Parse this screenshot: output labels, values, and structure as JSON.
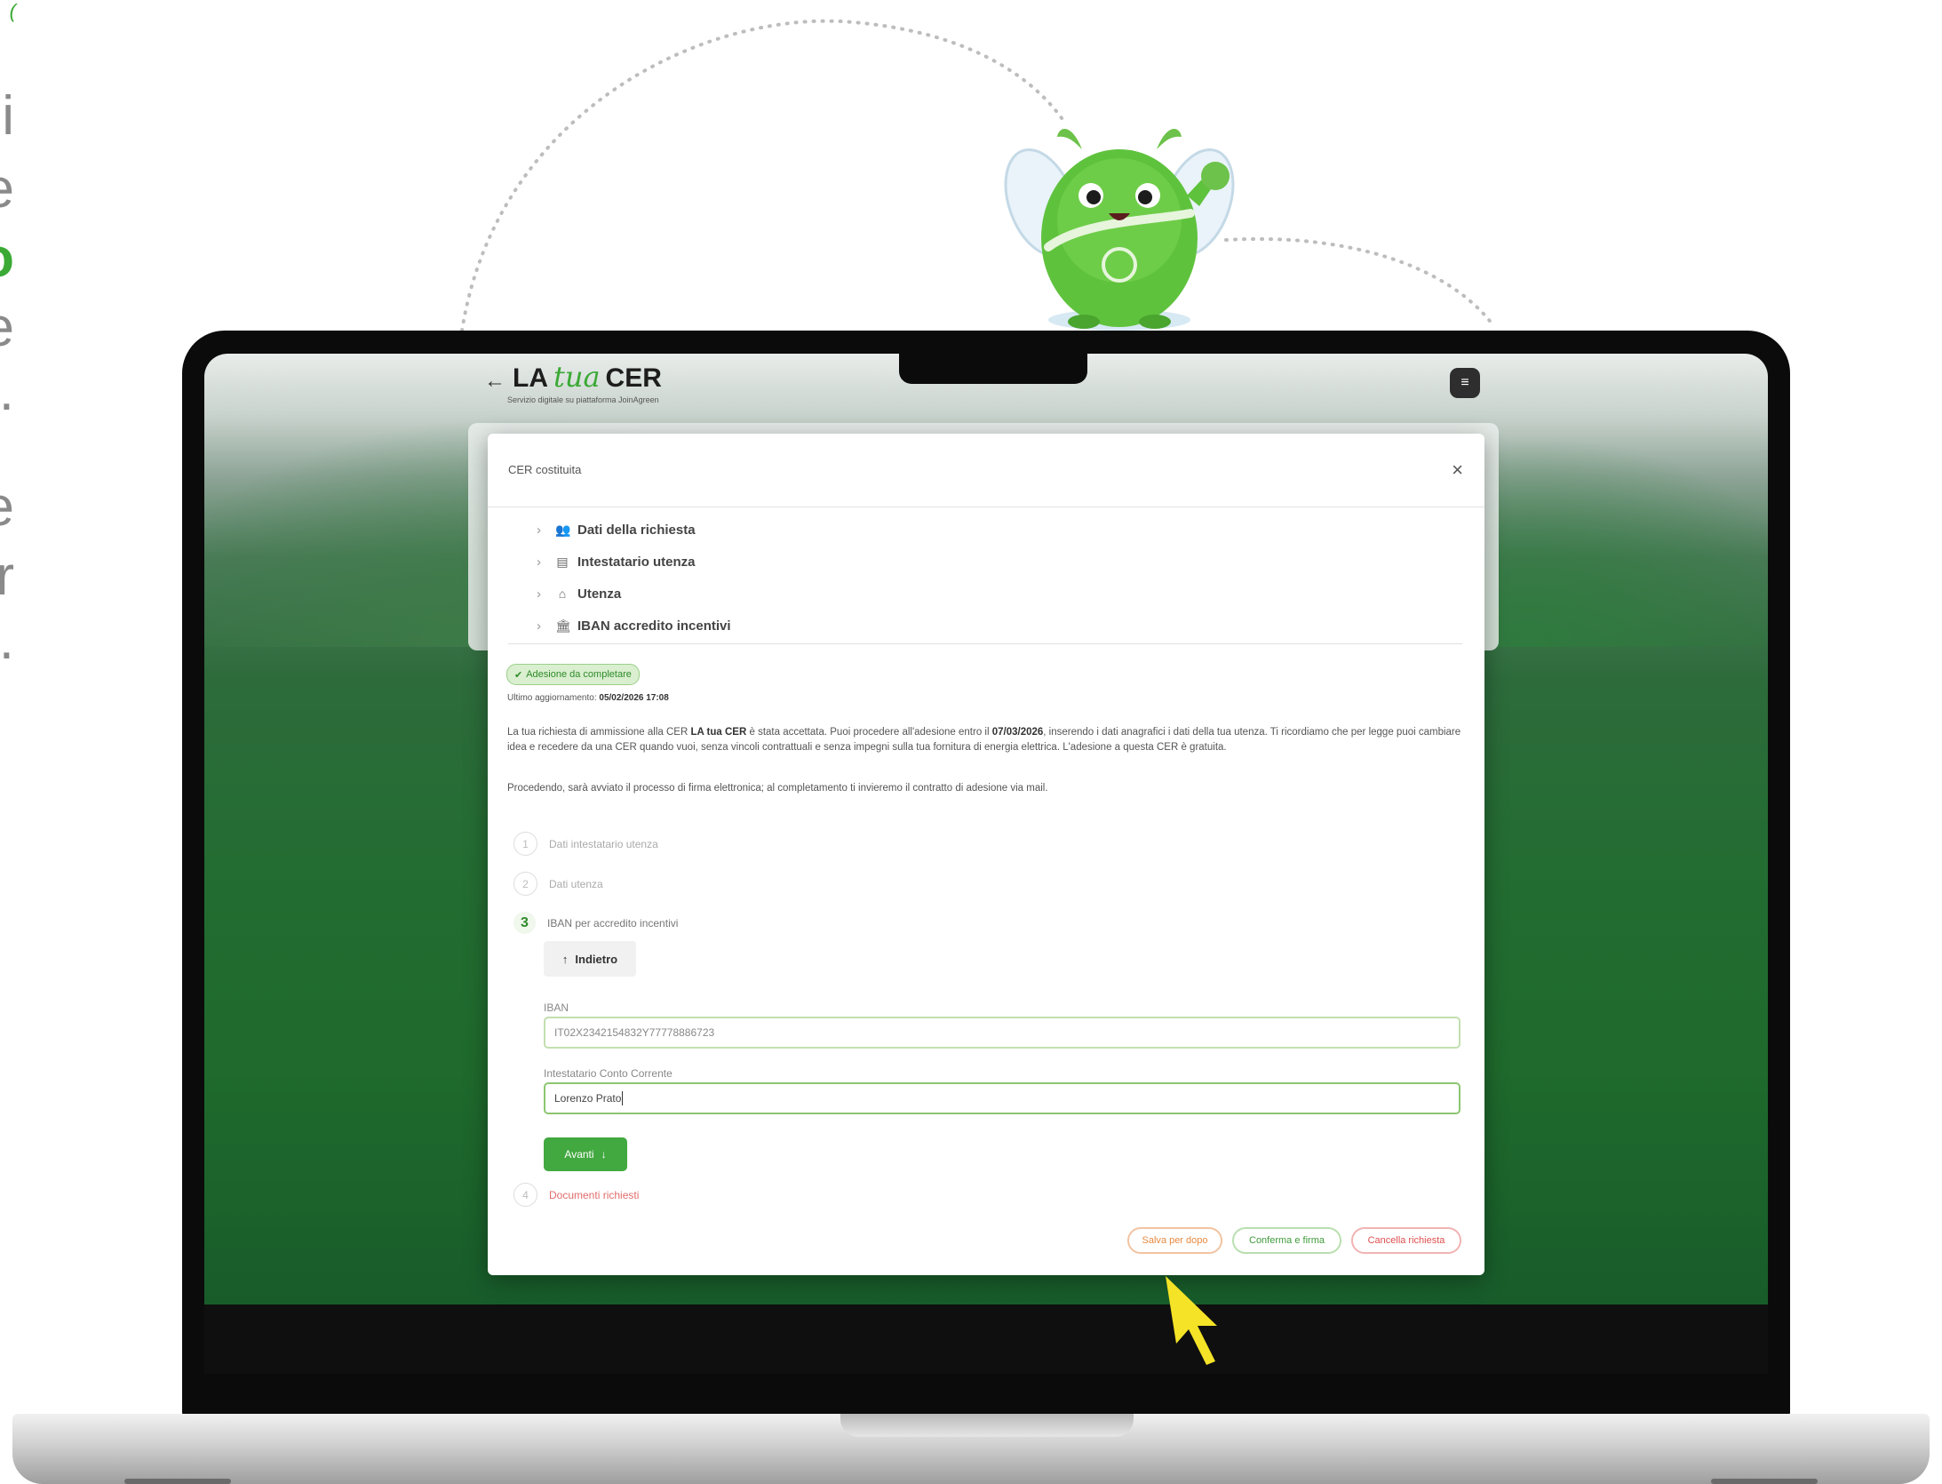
{
  "left_text": {
    "top_fragment": "(",
    "lines": [
      "i",
      "e",
      "o",
      "e",
      ".",
      "e",
      "r",
      "."
    ]
  },
  "app": {
    "brand_la": "LA",
    "brand_tua": "tua",
    "brand_cer": "CER",
    "brand_subtitle": "Servizio digitale su piattaforma JoinAgreen",
    "menu_icon": "menu-icon"
  },
  "modal": {
    "title": "CER costituita",
    "close": "×",
    "accordion": [
      {
        "label": "Dati della richiesta",
        "icon": "people-icon"
      },
      {
        "label": "Intestatario utenza",
        "icon": "document-icon"
      },
      {
        "label": "Utenza",
        "icon": "house-icon"
      },
      {
        "label": "IBAN accredito incentivi",
        "icon": "bank-icon"
      }
    ],
    "status_badge": "Adesione da completare",
    "updated_label": "Ultimo aggiornamento:",
    "updated_value": "05/02/2026 17:08",
    "para1_a": "La tua richiesta di ammissione alla CER ",
    "para1_b": "LA tua CER",
    "para1_c": " è stata accettata. Puoi procedere all'adesione entro il ",
    "para1_d": "07/03/2026",
    "para1_e": ", inserendo i dati anagrafici i dati della tua utenza. Ti ricordiamo che per legge puoi cambiare idea e recedere da una CER quando vuoi, senza vincoli contrattuali e senza impegni sulla tua fornitura di energia elettrica. L'adesione a questa CER è gratuita.",
    "para2": "Procedendo, sarà avviato il processo di firma elettronica; al completamento ti invieremo il contratto di adesione via mail.",
    "steps": [
      {
        "num": "1",
        "label": "Dati intestatario utenza"
      },
      {
        "num": "2",
        "label": "Dati utenza"
      },
      {
        "num": "3",
        "label": "IBAN per accredito incentivi"
      },
      {
        "num": "4",
        "label": "Documenti richiesti"
      }
    ],
    "back_button": "Indietro",
    "iban_label": "IBAN",
    "iban_value": "IT02X2342154832Y77778886723",
    "holder_label": "Intestatario Conto Corrente",
    "holder_value": "Lorenzo Prato",
    "next_button": "Avanti",
    "footer": {
      "save": "Salva per dopo",
      "confirm": "Conferma e firma",
      "cancel": "Cancella richiesta"
    }
  },
  "colors": {
    "accent_green": "#42a840",
    "save_orange": "#e88a3f",
    "cancel_red": "#de4f4f",
    "cursor_yellow": "#f4e326"
  }
}
